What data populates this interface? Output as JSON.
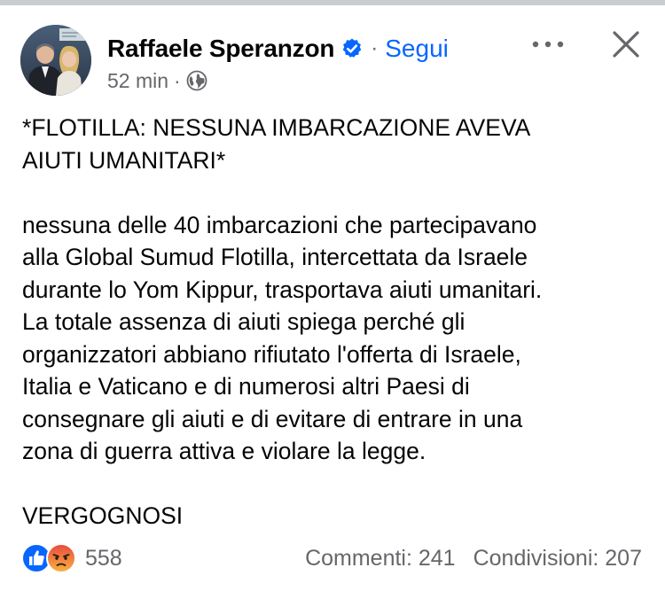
{
  "post": {
    "author": "Raffaele Speranzon",
    "follow_label": "Segui",
    "dot": "·",
    "time": "52 min",
    "meta_sep": "·",
    "title_lines": [
      "*FLOTILLA: NESSUNA IMBARCAZIONE AVEVA",
      "AIUTI UMANITARI*"
    ],
    "body_lines": [
      "nessuna delle 40 imbarcazioni che partecipavano",
      "alla Global Sumud Flotilla, intercettata da Israele",
      "durante lo Yom Kippur, trasportava aiuti umanitari.",
      "La totale assenza di aiuti spiega perché gli",
      "organizzatori abbiano rifiutato l'offerta di Israele,",
      "Italia e Vaticano e di numerosi altri Paesi di",
      "consegnare gli aiuti e di evitare di entrare in una",
      "zona di guerra attiva e violare la legge."
    ],
    "closing": "VERGOGNOSI"
  },
  "footer": {
    "reaction_count": "558",
    "comments": "Commenti: 241",
    "shares": "Condivisioni: 207"
  },
  "icons": {
    "verified": "verified-badge-icon",
    "globe": "globe-icon",
    "more": "more-options-icon",
    "close": "close-icon",
    "like": "like-reaction-icon",
    "angry": "angry-reaction-icon"
  },
  "colors": {
    "accent": "#0866ff",
    "secondary_text": "#65676b",
    "primary_text": "#050505",
    "verified": "#0866ff",
    "angry": "#f5683a"
  }
}
